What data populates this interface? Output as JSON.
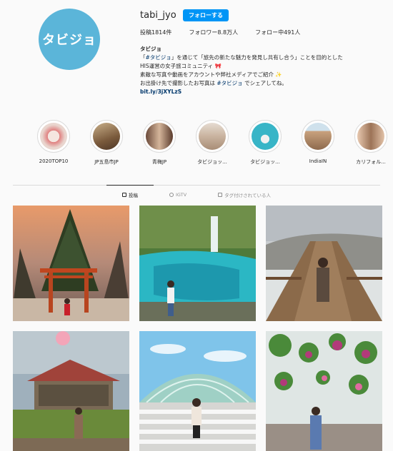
{
  "profile": {
    "avatar_text": "タビジョ",
    "username": "tabi_jyo",
    "follow_label": "フォローする",
    "posts": "投稿1814件",
    "followers": "フォロワー8.8万人",
    "following": "フォロー中491人"
  },
  "bio": {
    "name": "タビジョ",
    "line1_open": "「",
    "line1_tag": "#タビジョ",
    "line1_rest": "」を通じて「旅先の新たな魅力を発見し共有し合う」ことを目的とした",
    "line2": "HIS運営の女子旅コミュニティ 🎀",
    "line3": "素敵な写真や動画をアカウントや弊社メディアでご紹介 ✨",
    "line4_pre": "お出掛け先で撮影したお写真は ",
    "line4_tag": "#タビジョ",
    "line4_post": " でシェアしてね。",
    "link": "bit.ly/3jXYLzS"
  },
  "highlights": [
    {
      "label": "2020TOP10",
      "color": "#e9d6cf",
      "icon": "2020-tabijyo-post"
    },
    {
      "label": "JP五島市JP",
      "color": "#8b6b4a",
      "icon": "building"
    },
    {
      "label": "青梅JP",
      "color": "#9a7d6a",
      "icon": "friends"
    },
    {
      "label": "タビジョッ...",
      "color": "#b8a79a",
      "icon": "beach-hat"
    },
    {
      "label": "タビジョッ...",
      "color": "#3fb3c4",
      "icon": "llama"
    },
    {
      "label": "IndiaIN",
      "color": "#c9a27e",
      "icon": "palace"
    },
    {
      "label": "カリフォル...",
      "color": "#a8806a",
      "icon": "friends-selfie"
    }
  ],
  "tabs": [
    {
      "label": "投稿",
      "icon": "grid-icon"
    },
    {
      "label": "IGTV",
      "icon": "igtv-icon"
    },
    {
      "label": "タグ付けされている人",
      "icon": "tag-icon"
    }
  ],
  "posts": [
    {
      "scene": "torii-gate-cedar-tree"
    },
    {
      "scene": "waterfall-blue-pool"
    },
    {
      "scene": "boardwalk-steam-valley"
    },
    {
      "scene": "okinawa-pavilion-sakura"
    },
    {
      "scene": "glass-dome-crosswalk"
    },
    {
      "scene": "hanging-flower-greenhouse"
    }
  ]
}
